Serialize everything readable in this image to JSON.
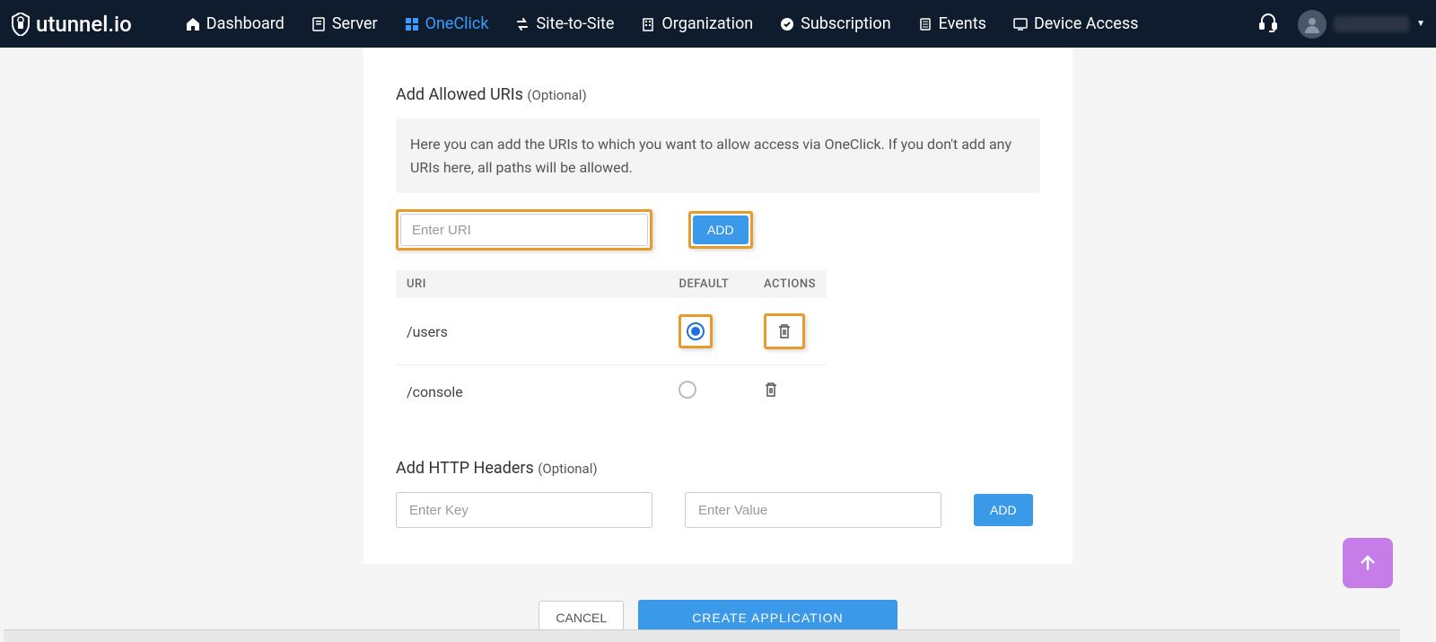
{
  "brand": "utunnel.io",
  "nav": {
    "dashboard": "Dashboard",
    "server": "Server",
    "oneclick": "OneClick",
    "site_to_site": "Site-to-Site",
    "organization": "Organization",
    "subscription": "Subscription",
    "events": "Events",
    "device_access": "Device Access"
  },
  "uris": {
    "title": "Add Allowed URIs ",
    "optional": "(Optional)",
    "info": "Here you can add the URIs to which you want to allow access via OneClick. If you don't add any URIs here, all paths will be allowed.",
    "placeholder": "Enter URI",
    "add_btn": "ADD",
    "col_uri": "URI",
    "col_default": "DEFAULT",
    "col_actions": "ACTIONS",
    "rows": [
      {
        "uri": "/users",
        "default": true
      },
      {
        "uri": "/console",
        "default": false
      }
    ]
  },
  "headers": {
    "title": "Add HTTP Headers ",
    "optional": "(Optional)",
    "key_placeholder": "Enter Key",
    "value_placeholder": "Enter Value",
    "add_btn": "ADD"
  },
  "footer": {
    "cancel": "CANCEL",
    "create": "CREATE APPLICATION"
  }
}
